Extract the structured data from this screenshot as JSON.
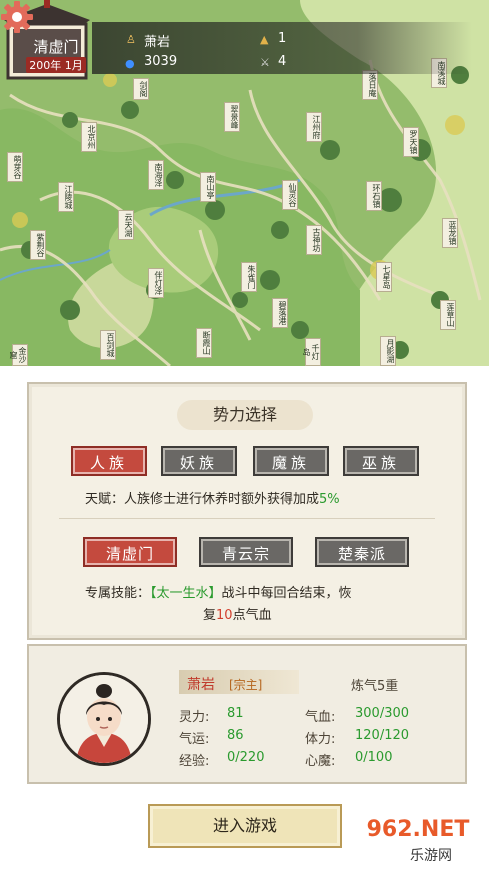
{
  "map": {
    "places": [
      "剑阁",
      "落日庵",
      "南溪城",
      "翠景峰",
      "江州府",
      "罗天镇",
      "北京州",
      "南海泽",
      "萌芽谷",
      "环石镇",
      "江陵城",
      "云天湖",
      "南山亭",
      "仙灵谷",
      "蓝龙镇",
      "古神坊",
      "七星岛",
      "莲草山",
      "紫荆谷",
      "伴灯泽",
      "朱雀门",
      "断霞山",
      "百剑城",
      "碧落港",
      "千灯岛",
      "月影湖",
      "金沙窟"
    ]
  },
  "header": {
    "sect_name": "清虚门",
    "date": "200年 1月",
    "player_name": "萧岩",
    "spirit_stones": "3039",
    "count1": "1",
    "count2": "4"
  },
  "selection": {
    "title": "势力选择",
    "races": [
      "人族",
      "妖族",
      "魔族",
      "巫族"
    ],
    "selected_race": "人族",
    "talent_prefix": "天赋：人族修士进行休养时额外获得加成",
    "talent_value": "5%",
    "sects": [
      "清虚门",
      "青云宗",
      "楚秦派"
    ],
    "selected_sect": "清虚门",
    "skill_label": "专属技能：",
    "skill_name": "【太一生水】",
    "skill_desc1": "战斗中每回合结束，恢",
    "skill_desc2_pre": "复",
    "skill_desc2_num": "10",
    "skill_desc2_post": "点气血"
  },
  "character": {
    "name": "萧岩",
    "title": "[宗主]",
    "realm": "炼气5重",
    "stats": {
      "lingli_label": "灵力:",
      "lingli": "81",
      "qixue_label": "气血:",
      "qixue": "300/300",
      "qiyun_label": "气运:",
      "qiyun": "86",
      "tili_label": "体力:",
      "tili": "120/120",
      "jingyan_label": "经验:",
      "jingyan": "0/220",
      "xinmo_label": "心魔:",
      "xinmo": "0/100"
    }
  },
  "enter_button": "进入游戏",
  "watermark": {
    "brand": "962.NET",
    "sub": "乐游网"
  },
  "colors": {
    "accent_red": "#c44a3e",
    "stat_green": "#2a9a2e",
    "map_green": "#8fb86a"
  }
}
